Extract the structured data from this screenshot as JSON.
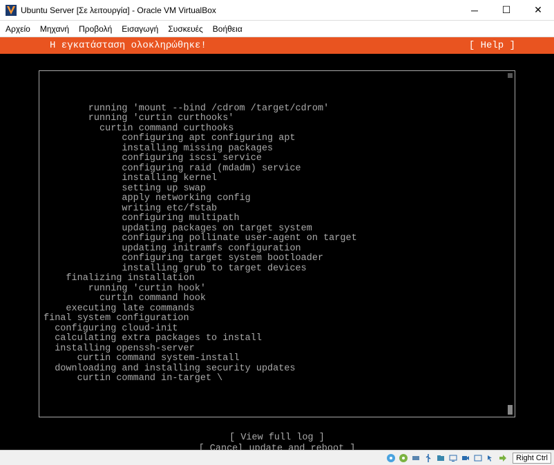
{
  "window": {
    "title": "Ubuntu Server [Σε λειτουργία] - Oracle VM VirtualBox"
  },
  "menubar": {
    "items": [
      "Αρχείο",
      "Μηχανή",
      "Προβολή",
      "Εισαγωγή",
      "Συσκευές",
      "Βοήθεια"
    ]
  },
  "installer": {
    "header": "Η εγκατάσταση ολοκληρώθηκε!",
    "help_label": "[ Help ]",
    "log_lines": [
      {
        "indent": 4,
        "text": "running 'mount --bind /cdrom /target/cdrom'"
      },
      {
        "indent": 4,
        "text": "running 'curtin curthooks'"
      },
      {
        "indent": 5,
        "text": "curtin command curthooks"
      },
      {
        "indent": 7,
        "text": "configuring apt configuring apt"
      },
      {
        "indent": 7,
        "text": "installing missing packages"
      },
      {
        "indent": 7,
        "text": "configuring iscsi service"
      },
      {
        "indent": 7,
        "text": "configuring raid (mdadm) service"
      },
      {
        "indent": 7,
        "text": "installing kernel"
      },
      {
        "indent": 7,
        "text": "setting up swap"
      },
      {
        "indent": 7,
        "text": "apply networking config"
      },
      {
        "indent": 7,
        "text": "writing etc/fstab"
      },
      {
        "indent": 7,
        "text": "configuring multipath"
      },
      {
        "indent": 7,
        "text": "updating packages on target system"
      },
      {
        "indent": 7,
        "text": "configuring pollinate user-agent on target"
      },
      {
        "indent": 7,
        "text": "updating initramfs configuration"
      },
      {
        "indent": 7,
        "text": "configuring target system bootloader"
      },
      {
        "indent": 7,
        "text": "installing grub to target devices"
      },
      {
        "indent": 2,
        "text": "finalizing installation"
      },
      {
        "indent": 4,
        "text": "running 'curtin hook'"
      },
      {
        "indent": 5,
        "text": "curtin command hook"
      },
      {
        "indent": 2,
        "text": "executing late commands"
      },
      {
        "indent": 0,
        "text": "final system configuration"
      },
      {
        "indent": 1,
        "text": "configuring cloud-init"
      },
      {
        "indent": 1,
        "text": "calculating extra packages to install"
      },
      {
        "indent": 1,
        "text": "installing openssh-server"
      },
      {
        "indent": 3,
        "text": "curtin command system-install"
      },
      {
        "indent": 1,
        "text": "downloading and installing security updates"
      },
      {
        "indent": 3,
        "text": "curtin command in-target \\"
      }
    ],
    "buttons": {
      "view_log": "[ View full log            ]",
      "cancel_reboot": "[ Cancel update and reboot ]"
    }
  },
  "statusbar": {
    "hostkey": "Right Ctrl"
  }
}
